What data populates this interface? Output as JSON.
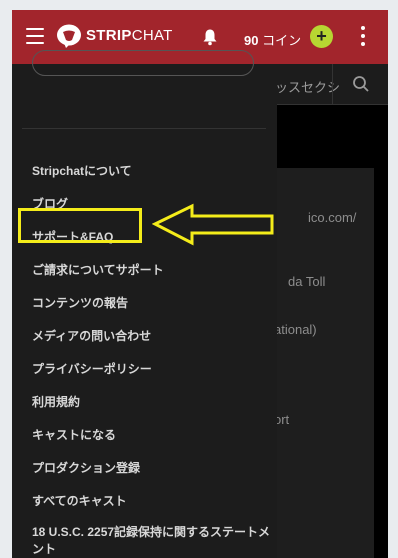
{
  "header": {
    "brand": "STRIP",
    "brand_light": "CHAT",
    "coins_amount": "90",
    "coins_unit": " コイン",
    "add_coins": "+"
  },
  "background": {
    "tab_text": "ッスセクシ",
    "line1": "ico.com/",
    "line2": "da Toll",
    "line3": "ational)",
    "line4": "ort"
  },
  "drawer": {
    "items": [
      {
        "label": "Stripchatについて"
      },
      {
        "label": "ブログ"
      },
      {
        "label": "サポート&FAQ"
      },
      {
        "label": "ご請求についてサポート"
      },
      {
        "label": "コンテンツの報告"
      },
      {
        "label": "メディアの問い合わせ"
      },
      {
        "label": "プライバシーポリシー"
      },
      {
        "label": "利用規約"
      },
      {
        "label": "キャストになる"
      },
      {
        "label": "プロダクション登録"
      },
      {
        "label": "すべてのキャスト"
      },
      {
        "label": "18 U.S.C. 2257記録保持に関するステートメント"
      }
    ]
  },
  "colors": {
    "header_bg": "#a2252c",
    "accent_green": "#b7d632",
    "highlight_yellow": "#f4ec1a"
  }
}
